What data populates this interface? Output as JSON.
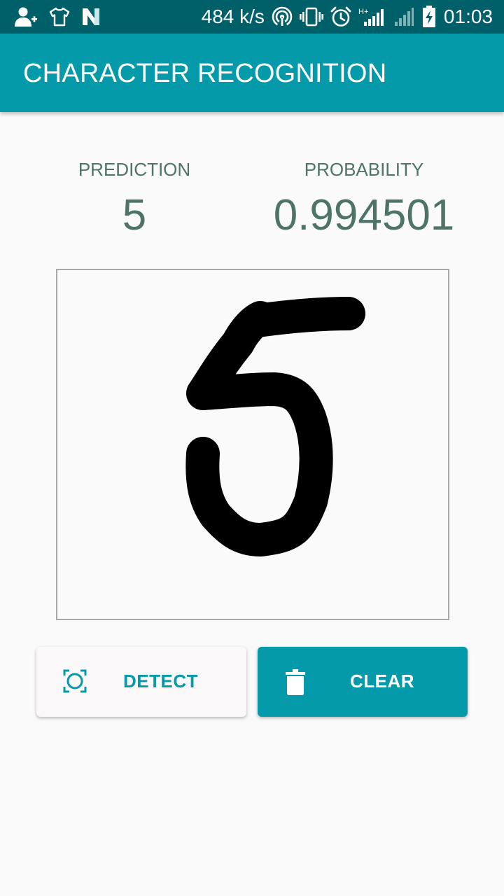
{
  "status_bar": {
    "net_speed": "484 k/s",
    "time": "01:03",
    "icons": [
      "add-contact-icon",
      "shirt-icon",
      "n-logo-icon",
      "hotspot-icon",
      "vibrate-icon",
      "alarm-icon",
      "signal-h-plus-icon",
      "signal-icon",
      "battery-charging-icon"
    ]
  },
  "app_bar": {
    "title": "CHARACTER RECOGNITION"
  },
  "result": {
    "prediction_label": "PREDICTION",
    "prediction_value": "5",
    "probability_label": "PROBABILITY",
    "probability_value": "0.994501"
  },
  "canvas": {
    "stroke_color": "#000000",
    "drawn_character": "5"
  },
  "buttons": {
    "detect_label": "DETECT",
    "detect_icon": "scan-focus-icon",
    "clear_label": "CLEAR",
    "clear_icon": "trash-icon"
  },
  "colors": {
    "primary": "#049aaa",
    "primary_dark": "#00606a",
    "text_secondary": "#4e7369",
    "background": "#fafafa"
  }
}
